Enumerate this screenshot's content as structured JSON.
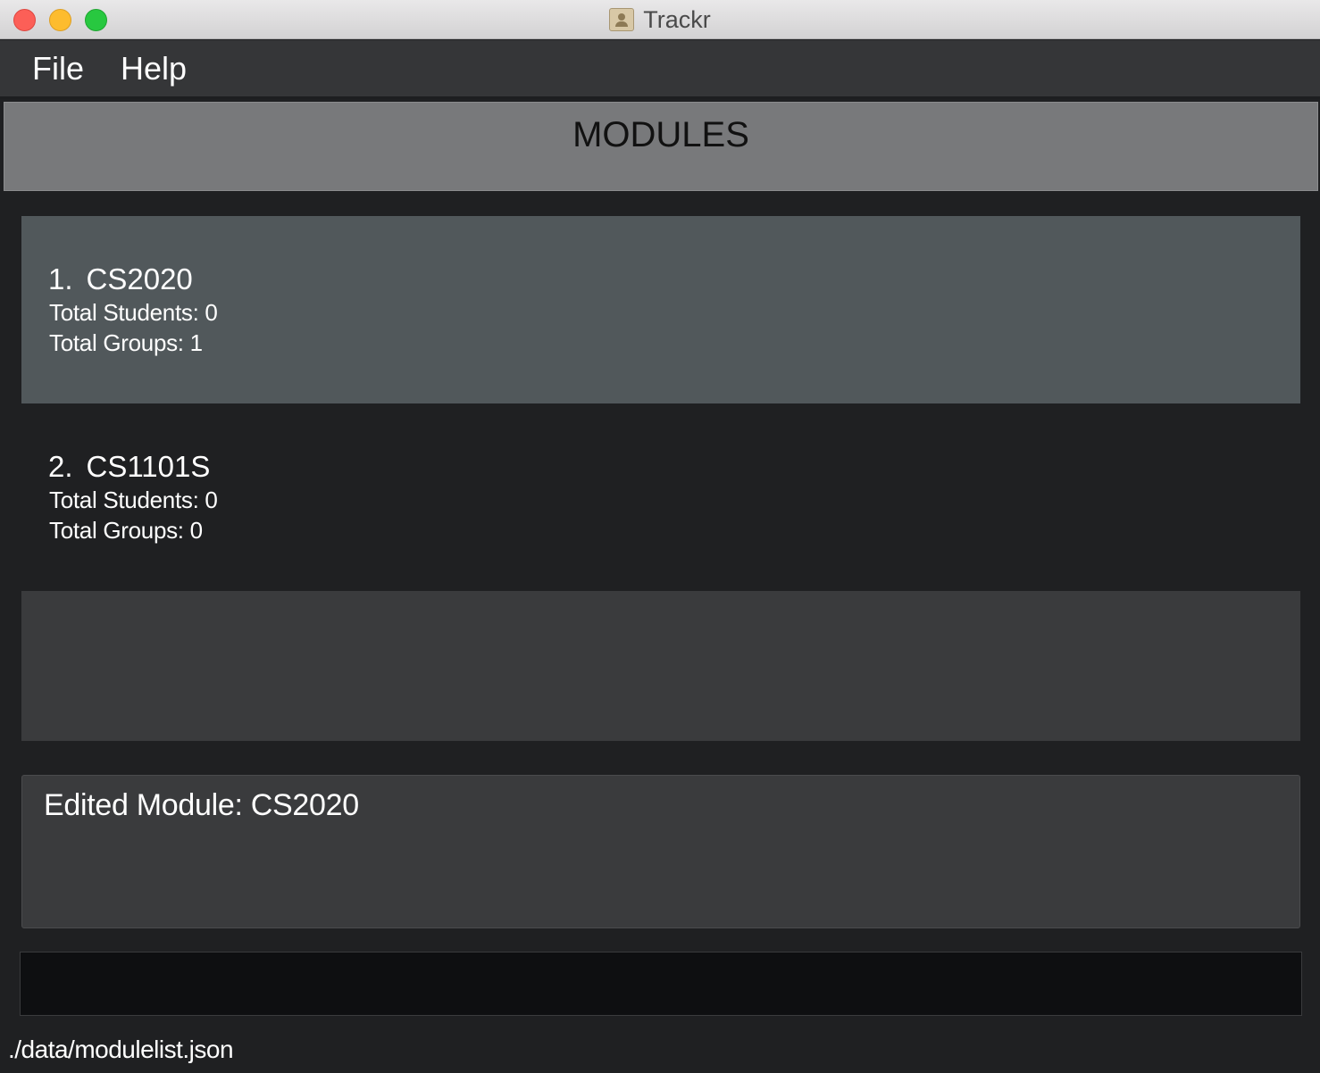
{
  "window": {
    "title": "Trackr"
  },
  "menu": {
    "file_label": "File",
    "help_label": "Help"
  },
  "header": {
    "title": "MODULES"
  },
  "modules": [
    {
      "index": "1.",
      "code": "CS2020",
      "students": "Total Students: 0",
      "groups": "Total Groups: 1",
      "selected": true
    },
    {
      "index": "2.",
      "code": "CS1101S",
      "students": "Total Students: 0",
      "groups": "Total Groups: 0",
      "selected": false
    }
  ],
  "result": {
    "text": "Edited Module: CS2020"
  },
  "command": {
    "value": ""
  },
  "status": {
    "path": "./data/modulelist.json"
  },
  "colors": {
    "background": "#1f2022",
    "menubar": "#353638",
    "header": "#78797b",
    "selected_card": "#51585b",
    "panel": "#3a3b3d",
    "command_box": "#0e0f11"
  }
}
